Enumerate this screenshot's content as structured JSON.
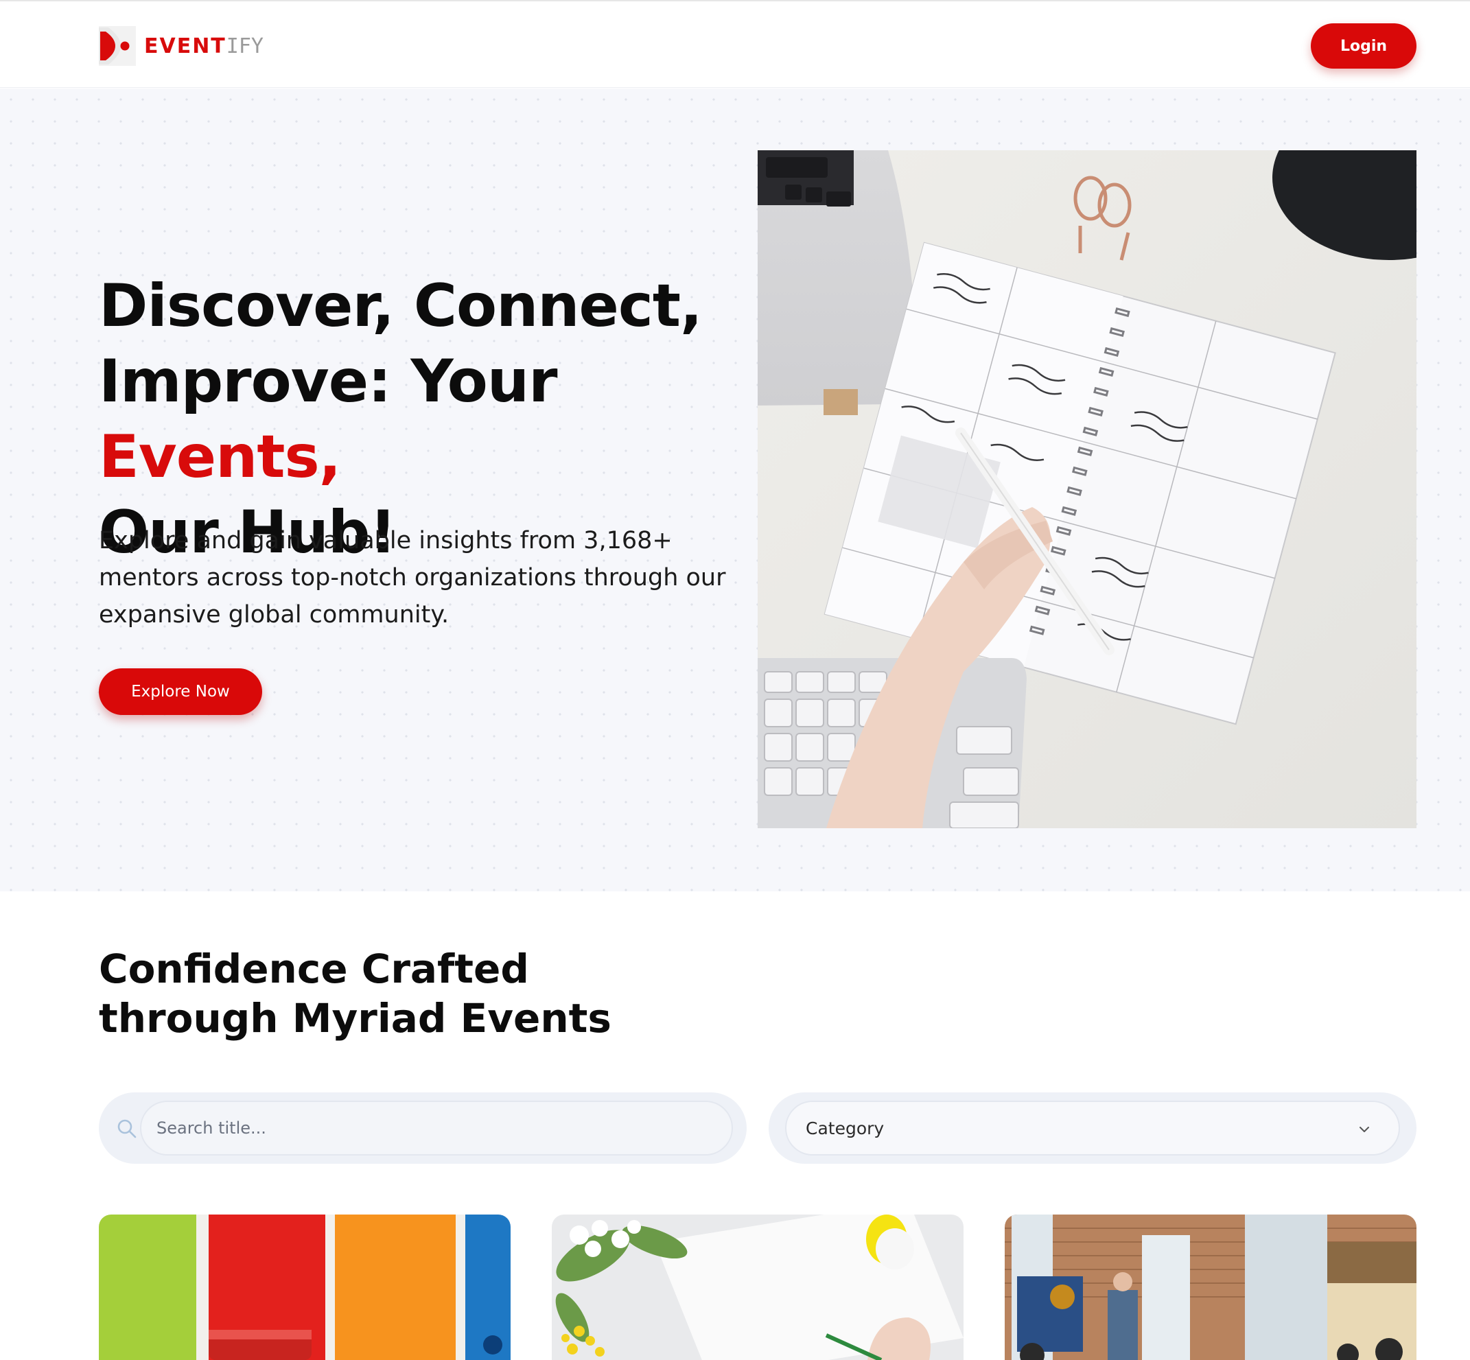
{
  "header": {
    "logo": {
      "brand": "EVENT",
      "brand_tail": "IFY"
    },
    "login_label": "Login"
  },
  "hero": {
    "title_line1": "Discover, Connect,",
    "title_line2_pre": "Improve: Your ",
    "title_accent": "Events,",
    "title_line3": "Our Hub!",
    "description": "Explore and gain valuable insights from 3,168+ mentors across top-notch organizations through our expansive global community.",
    "cta_label": "Explore Now",
    "image_icon": "planner-notebook-photo"
  },
  "events": {
    "section_title": "Confidence Crafted through Myriad Events",
    "search": {
      "placeholder": "Search title...",
      "icon": "search-icon"
    },
    "category": {
      "label": "Category",
      "icon": "chevron-down-icon"
    },
    "cards": [
      {
        "image": "paint-stripes-photo"
      },
      {
        "image": "flowers-desk-photo"
      },
      {
        "image": "conference-talk-photo"
      }
    ]
  },
  "colors": {
    "brand_red": "#d80b0b",
    "hero_bg": "#f6f7fb",
    "input_bg": "#eef1f7"
  }
}
